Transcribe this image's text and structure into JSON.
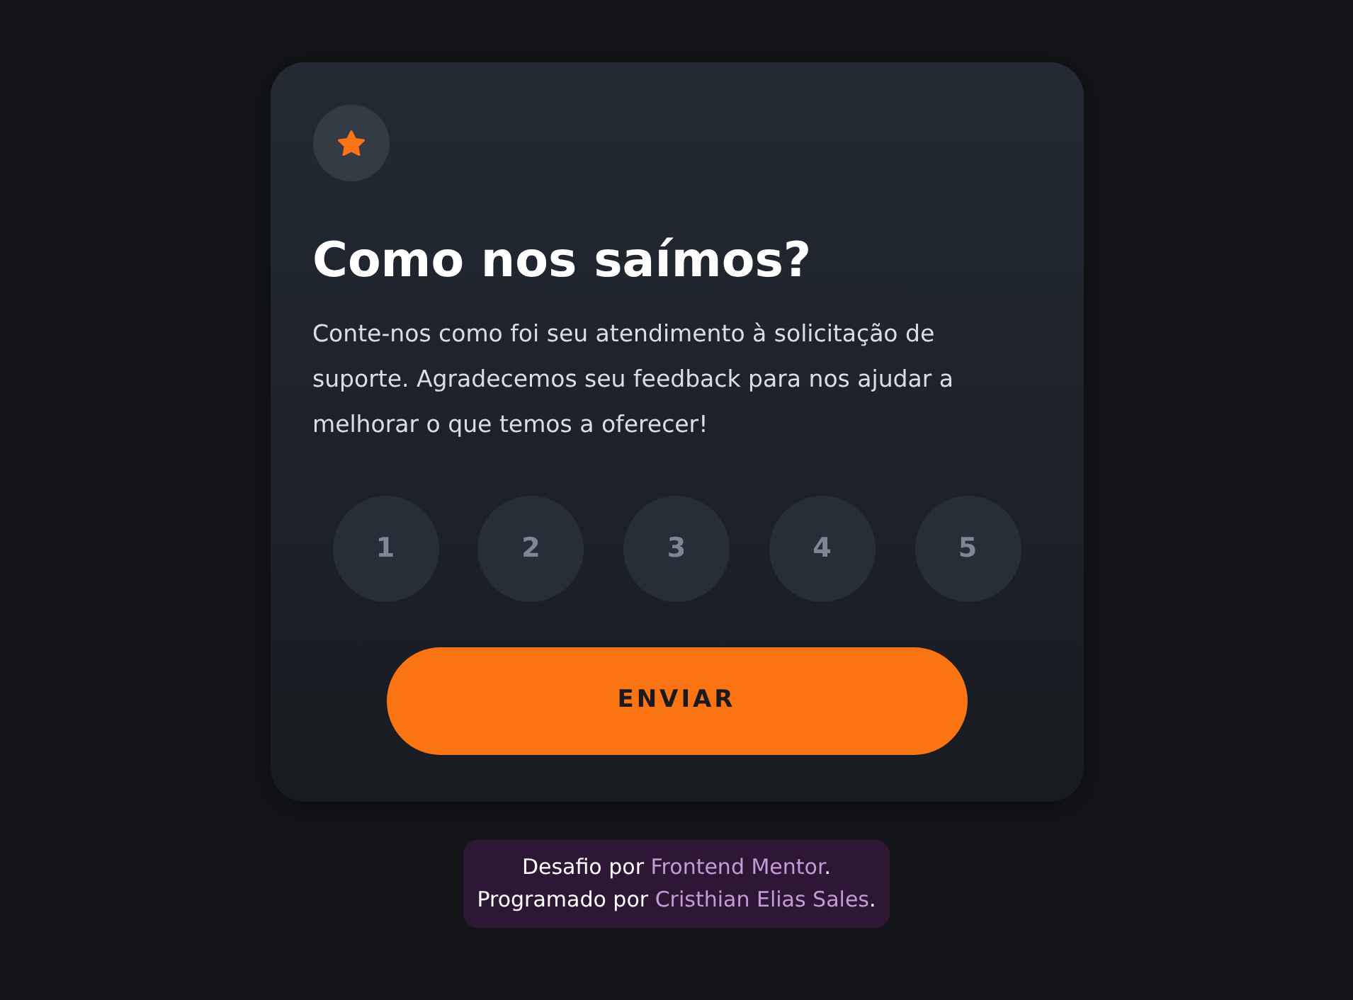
{
  "card": {
    "title": "Como nos saímos?",
    "description": "Conte-nos como foi seu atendimento à solicitação de suporte. Agradecemos seu feedback para nos ajudar a melhorar o que temos a oferecer!",
    "ratings": [
      {
        "label": "1",
        "selected": false
      },
      {
        "label": "2",
        "selected": false
      },
      {
        "label": "3",
        "selected": false
      },
      {
        "label": "4",
        "selected": false
      },
      {
        "label": "5",
        "selected": false
      }
    ],
    "submit": "ENVIAR"
  },
  "attribution": [
    {
      "prefix": "Desafio por",
      "link": "Frontend Mentor",
      "suffix": "."
    },
    {
      "prefix": "Programado por",
      "link": "Cristhian Elias Sales",
      "suffix": "."
    }
  ]
}
